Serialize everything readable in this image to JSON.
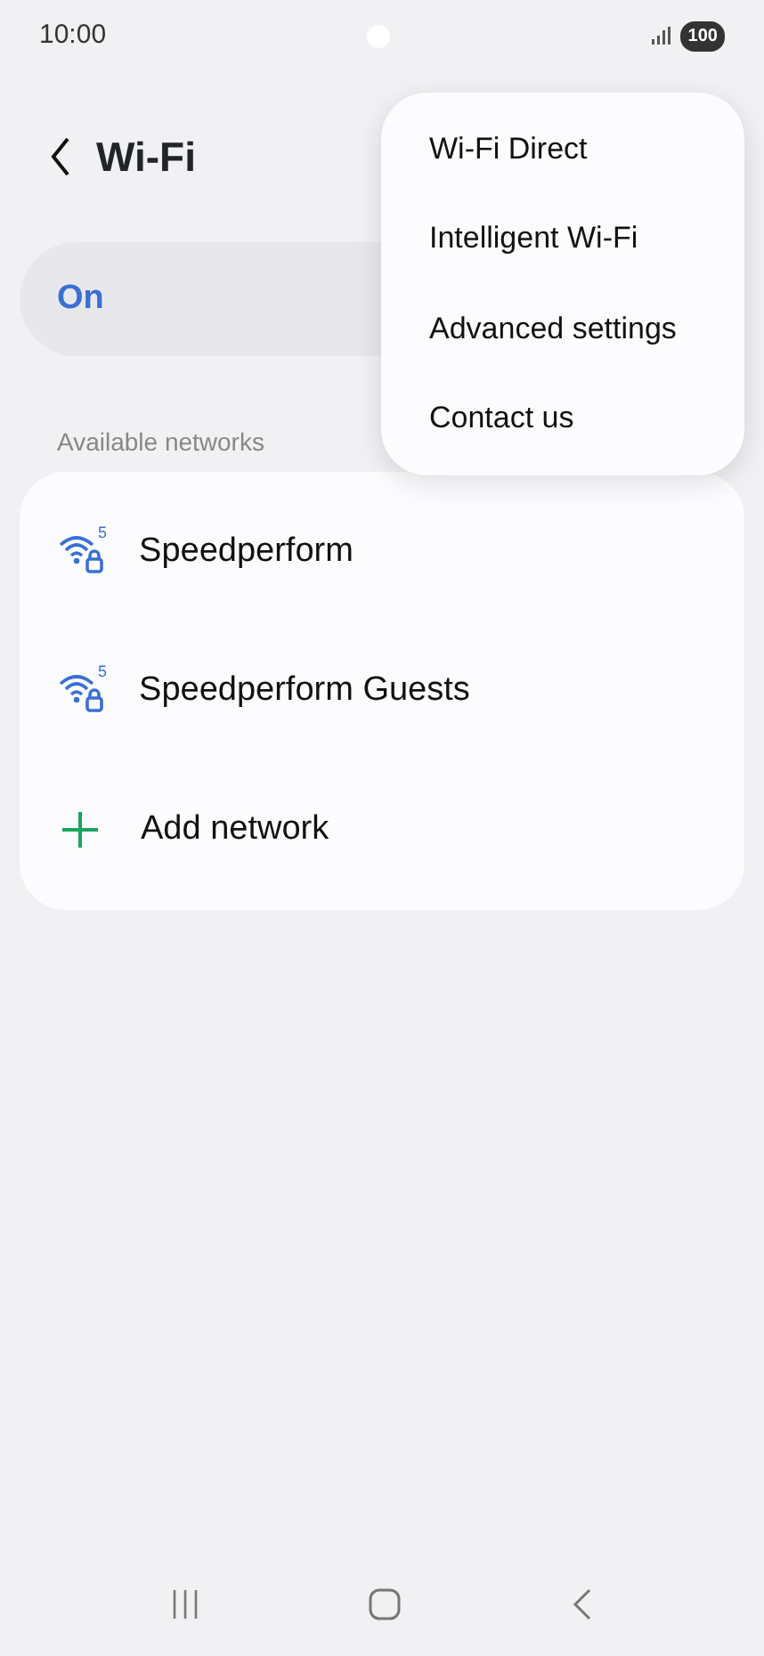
{
  "status_bar": {
    "time": "10:00",
    "battery": "100"
  },
  "header": {
    "title": "Wi-Fi"
  },
  "master_switch": {
    "label": "On"
  },
  "section_label": "Available networks",
  "networks": [
    {
      "kind": "network",
      "name": "Speedperform",
      "band": "5"
    },
    {
      "kind": "network",
      "name": "Speedperform Guests",
      "band": "5"
    },
    {
      "kind": "add",
      "name": "Add network"
    }
  ],
  "menu": [
    "Wi-Fi Direct",
    "Intelligent Wi-Fi",
    "Advanced settings",
    "Contact us"
  ]
}
